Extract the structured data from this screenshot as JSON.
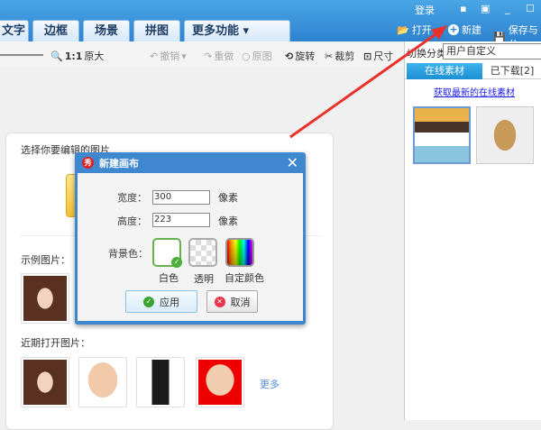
{
  "header": {
    "login": "登录",
    "tabs": [
      "文字",
      "边框",
      "场景",
      "拼图",
      "更多功能"
    ],
    "actions": {
      "open": "打开",
      "new": "新建",
      "save": "保存与分"
    }
  },
  "toolbar": {
    "zoom_ratio": "1:1",
    "original_size": "原大",
    "undo": "撤销",
    "redo": "重做",
    "original": "原图",
    "rotate": "旋转",
    "crop": "裁剪",
    "size": "尺寸"
  },
  "right_panel": {
    "category_label": "切换分类",
    "category_value": "用户自定义",
    "tabs": [
      "在线素材",
      "已下载[2]"
    ],
    "link": "获取最新的在线素材"
  },
  "main": {
    "select_label": "选择你要编辑的图片",
    "sample_label": "示例图片：",
    "recent_label": "近期打开图片：",
    "more": "更多"
  },
  "dialog": {
    "title": "新建画布",
    "width_label": "宽度：",
    "width_value": "300",
    "height_label": "高度：",
    "height_value": "223",
    "unit": "像素",
    "bg_label": "背景色：",
    "options": [
      "白色",
      "透明",
      "自定颜色"
    ],
    "apply": "应用",
    "cancel": "取消"
  },
  "colors": {
    "accent": "#2e82cf",
    "selected": "#6ab04c",
    "arrow": "#e8322c"
  }
}
